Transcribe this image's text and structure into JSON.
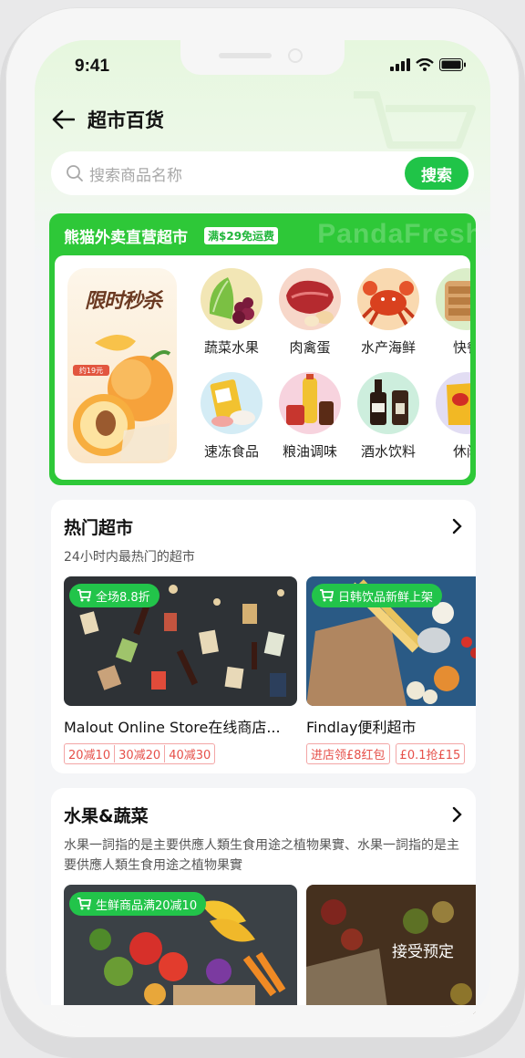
{
  "status_bar": {
    "time": "9:41"
  },
  "nav": {
    "title": "超市百货"
  },
  "search": {
    "placeholder": "搜索商品名称",
    "button": "搜索"
  },
  "panda_section": {
    "title": "熊猫外卖直营超市",
    "badge": "满$29免运费",
    "watermark": "PandaFresh",
    "promo_text": "限时秒杀",
    "promo_price_tag": "约19元",
    "categories": [
      {
        "label": "蔬菜水果",
        "icon": "vegetables-icon",
        "color": "#f2e6b5"
      },
      {
        "label": "肉禽蛋",
        "icon": "meat-icon",
        "color": "#f7d7c9"
      },
      {
        "label": "水产海鲜",
        "icon": "seafood-icon",
        "color": "#f9d9b0"
      },
      {
        "label": "快餐",
        "icon": "fastfood-icon",
        "color": "#dbeec9"
      },
      {
        "label": "速冻食品",
        "icon": "frozen-food-icon",
        "color": "#d4ecf5"
      },
      {
        "label": "粮油调味",
        "icon": "grain-oil-icon",
        "color": "#f7d3de"
      },
      {
        "label": "酒水饮料",
        "icon": "drinks-icon",
        "color": "#cdeedd"
      },
      {
        "label": "休闲",
        "icon": "snacks-icon",
        "color": "#e2ddf3"
      }
    ]
  },
  "hot_stores": {
    "title": "热门超市",
    "subtitle": "24小时内最热门的超市",
    "stores": [
      {
        "tag": "全场8.8折",
        "name": "Malout Online Store在线商店...",
        "coupons": [
          "20减10",
          "30减20",
          "40减30"
        ]
      },
      {
        "tag": "日韩饮品新鲜上架",
        "name": "Findlay便利超市",
        "coupons": [
          "进店领£8红包",
          "£0.1抢£15"
        ]
      }
    ]
  },
  "fruit_veg": {
    "title": "水果&蔬菜",
    "description": "水果一詞指的是主要供應人類生食用途之植物果實、水果一詞指的是主要供應人類生食用途之植物果實",
    "stores": [
      {
        "tag": "生鲜商品满20减10",
        "overlay": ""
      },
      {
        "tag": "",
        "overlay": "接受预定"
      }
    ]
  },
  "colors": {
    "accent": "#20c448",
    "panda_green": "#2ec838",
    "coupon_red": "#e6504a"
  }
}
